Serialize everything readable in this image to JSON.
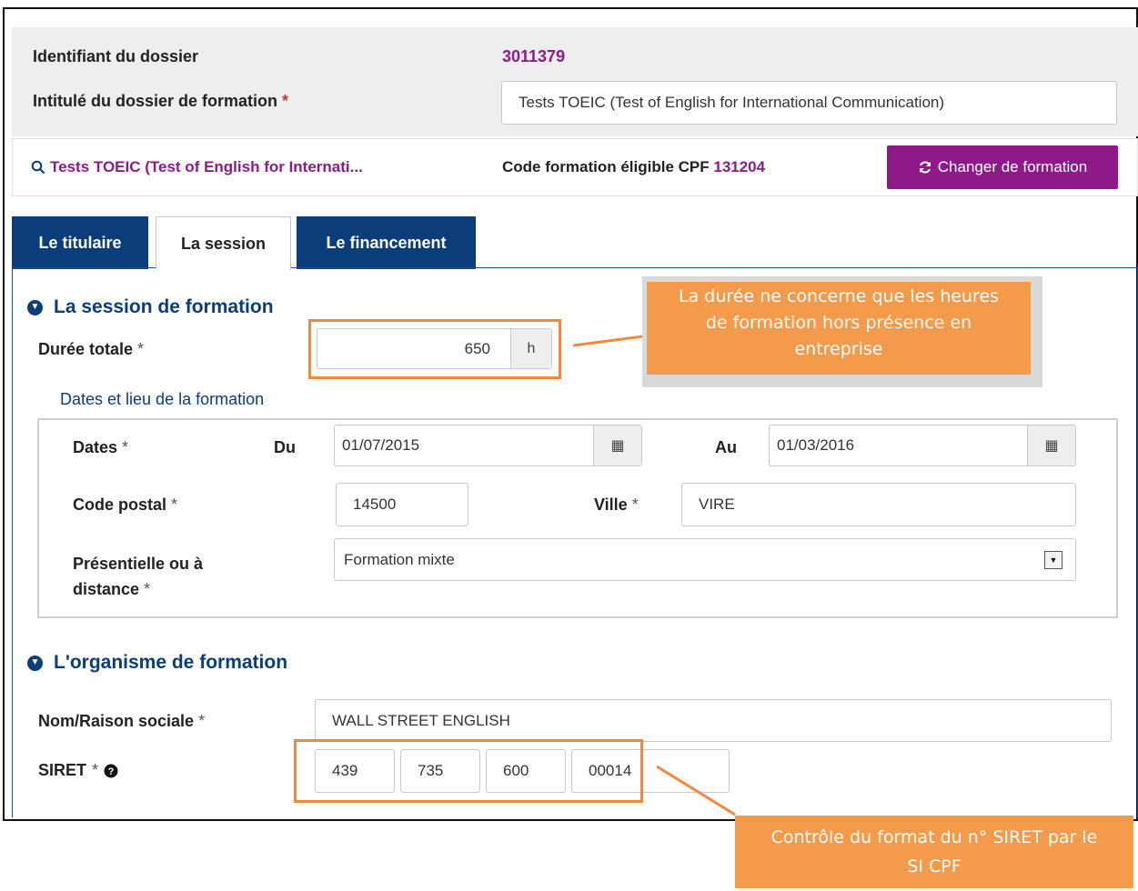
{
  "dossier": {
    "id_label": "Identifiant du dossier",
    "id_value": "3011379",
    "title_label": "Intitulé du dossier de formation",
    "required_mark": "*",
    "title_value": "Tests TOEIC (Test of English for International Communication)"
  },
  "formation": {
    "link_text": "Tests TOEIC (Test of English for Internati...",
    "code_label": "Code formation éligible CPF",
    "code_value": "131204",
    "change_button": "Changer de formation"
  },
  "tabs": [
    {
      "label": "Le titulaire",
      "active": false
    },
    {
      "label": "La session",
      "active": true
    },
    {
      "label": "Le financement",
      "active": false
    }
  ],
  "session": {
    "section_title": "La session de formation",
    "duree_label": "Durée totale",
    "duree_value": "650",
    "duree_unit": "h",
    "dates_group_title": "Dates et lieu de la formation",
    "dates_label": "Dates",
    "du_label": "Du",
    "du_value": "01/07/2015",
    "au_label": "Au",
    "au_value": "01/03/2016",
    "cp_label": "Code postal",
    "cp_value": "14500",
    "ville_label": "Ville",
    "ville_value": "VIRE",
    "mode_label_line1": "Présentielle ou à",
    "mode_label_line2": "distance",
    "mode_value": "Formation mixte"
  },
  "organisme": {
    "section_title": "L'organisme de formation",
    "nom_label": "Nom/Raison sociale",
    "nom_value": "WALL STREET ENGLISH",
    "siret_label": "SIRET",
    "siret_parts": [
      "439",
      "735",
      "600",
      "00014"
    ]
  },
  "callouts": {
    "duree_note_l1": "La durée ne concerne que les heures",
    "duree_note_l2": "de formation hors présence en",
    "duree_note_l3": "entreprise",
    "siret_note_l1": "Contrôle du format du n° SIRET par le",
    "siret_note_l2": "SI CPF"
  },
  "icons": [
    "search-icon",
    "refresh-icon",
    "chevron-down-icon",
    "calendar-icon",
    "help-icon",
    "dropdown-arrow-icon"
  ],
  "colors": {
    "brand_purple": "#8e1a8a",
    "navy": "#0a3d7a",
    "callout_orange": "#f49a4b"
  }
}
